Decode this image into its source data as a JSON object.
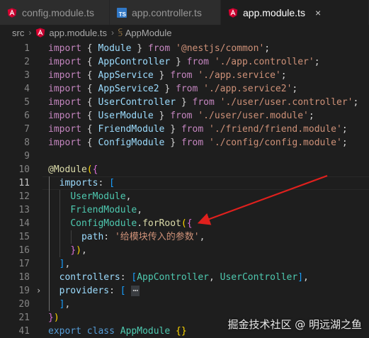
{
  "tabs": [
    {
      "label": "config.module.ts",
      "icon": "angular-icon",
      "active": false
    },
    {
      "label": "app.controller.ts",
      "icon": "typescript-icon",
      "active": false
    },
    {
      "label": "app.module.ts",
      "icon": "angular-icon",
      "active": true
    }
  ],
  "close_glyph": "×",
  "breadcrumb": {
    "folder": "src",
    "file": "app.module.ts",
    "symbol": "AppModule"
  },
  "lines": [
    {
      "n": "1",
      "t": [
        [
          "kw",
          "import"
        ],
        [
          "pun",
          " "
        ],
        [
          "pun",
          "{"
        ],
        [
          "id",
          " Module "
        ],
        [
          "pun",
          "}"
        ],
        [
          "kw",
          " from "
        ],
        [
          "str",
          "'@nestjs/common'"
        ],
        [
          "pun",
          ";"
        ]
      ]
    },
    {
      "n": "2",
      "t": [
        [
          "kw",
          "import"
        ],
        [
          "pun",
          " "
        ],
        [
          "pun",
          "{"
        ],
        [
          "id",
          " AppController "
        ],
        [
          "pun",
          "}"
        ],
        [
          "kw",
          " from "
        ],
        [
          "str",
          "'./app.controller'"
        ],
        [
          "pun",
          ";"
        ]
      ]
    },
    {
      "n": "3",
      "t": [
        [
          "kw",
          "import"
        ],
        [
          "pun",
          " "
        ],
        [
          "pun",
          "{"
        ],
        [
          "id",
          " AppService "
        ],
        [
          "pun",
          "}"
        ],
        [
          "kw",
          " from "
        ],
        [
          "str",
          "'./app.service'"
        ],
        [
          "pun",
          ";"
        ]
      ]
    },
    {
      "n": "4",
      "t": [
        [
          "kw",
          "import"
        ],
        [
          "pun",
          " "
        ],
        [
          "pun",
          "{"
        ],
        [
          "id",
          " AppService2 "
        ],
        [
          "pun",
          "}"
        ],
        [
          "kw",
          " from "
        ],
        [
          "str",
          "'./app.service2'"
        ],
        [
          "pun",
          ";"
        ]
      ]
    },
    {
      "n": "5",
      "t": [
        [
          "kw",
          "import"
        ],
        [
          "pun",
          " "
        ],
        [
          "pun",
          "{"
        ],
        [
          "id",
          " UserController "
        ],
        [
          "pun",
          "}"
        ],
        [
          "kw",
          " from "
        ],
        [
          "str",
          "'./user/user.controller'"
        ],
        [
          "pun",
          ";"
        ]
      ]
    },
    {
      "n": "6",
      "t": [
        [
          "kw",
          "import"
        ],
        [
          "pun",
          " "
        ],
        [
          "pun",
          "{"
        ],
        [
          "id",
          " UserModule "
        ],
        [
          "pun",
          "}"
        ],
        [
          "kw",
          " from "
        ],
        [
          "str",
          "'./user/user.module'"
        ],
        [
          "pun",
          ";"
        ]
      ]
    },
    {
      "n": "7",
      "t": [
        [
          "kw",
          "import"
        ],
        [
          "pun",
          " "
        ],
        [
          "pun",
          "{"
        ],
        [
          "id",
          " FriendModule "
        ],
        [
          "pun",
          "}"
        ],
        [
          "kw",
          " from "
        ],
        [
          "str",
          "'./friend/friend.module'"
        ],
        [
          "pun",
          ";"
        ]
      ]
    },
    {
      "n": "8",
      "t": [
        [
          "kw",
          "import"
        ],
        [
          "pun",
          " "
        ],
        [
          "pun",
          "{"
        ],
        [
          "id",
          " ConfigModule "
        ],
        [
          "pun",
          "}"
        ],
        [
          "kw",
          " from "
        ],
        [
          "str",
          "'./config/config.module'"
        ],
        [
          "pun",
          ";"
        ]
      ]
    },
    {
      "n": "9",
      "t": []
    },
    {
      "n": "10",
      "t": [
        [
          "fn",
          "@Module"
        ],
        [
          "b1",
          "("
        ],
        [
          "b2",
          "{"
        ]
      ]
    },
    {
      "n": "11",
      "t": [
        [
          "pun",
          "  "
        ],
        [
          "id",
          "imports"
        ],
        [
          "pun",
          ": "
        ],
        [
          "b3",
          "["
        ]
      ]
    },
    {
      "n": "12",
      "t": [
        [
          "pun",
          "    "
        ],
        [
          "cls",
          "UserModule"
        ],
        [
          "pun",
          ","
        ]
      ]
    },
    {
      "n": "13",
      "t": [
        [
          "pun",
          "    "
        ],
        [
          "cls",
          "FriendModule"
        ],
        [
          "pun",
          ","
        ]
      ]
    },
    {
      "n": "14",
      "t": [
        [
          "pun",
          "    "
        ],
        [
          "cls",
          "ConfigModule"
        ],
        [
          "pun",
          "."
        ],
        [
          "fn",
          "forRoot"
        ],
        [
          "b1",
          "("
        ],
        [
          "b2",
          "{"
        ]
      ]
    },
    {
      "n": "15",
      "t": [
        [
          "pun",
          "      "
        ],
        [
          "id",
          "path"
        ],
        [
          "pun",
          ": "
        ],
        [
          "str",
          "'给模块传入的参数'"
        ],
        [
          "pun",
          ","
        ]
      ]
    },
    {
      "n": "16",
      "t": [
        [
          "pun",
          "    "
        ],
        [
          "b2",
          "}"
        ],
        [
          "b1",
          ")"
        ],
        [
          "pun",
          ","
        ]
      ]
    },
    {
      "n": "17",
      "t": [
        [
          "pun",
          "  "
        ],
        [
          "b3",
          "]"
        ],
        [
          "pun",
          ","
        ]
      ]
    },
    {
      "n": "18",
      "t": [
        [
          "pun",
          "  "
        ],
        [
          "id",
          "controllers"
        ],
        [
          "pun",
          ": "
        ],
        [
          "b3",
          "["
        ],
        [
          "cls",
          "AppController"
        ],
        [
          "pun",
          ", "
        ],
        [
          "cls",
          "UserController"
        ],
        [
          "b3",
          "]"
        ],
        [
          "pun",
          ","
        ]
      ]
    },
    {
      "n": "19",
      "t": [
        [
          "pun",
          "  "
        ],
        [
          "id",
          "providers"
        ],
        [
          "pun",
          ": "
        ],
        [
          "b3",
          "["
        ],
        [
          "pun",
          " "
        ],
        [
          "ell",
          "⋯"
        ]
      ],
      "folded": true
    },
    {
      "n": "20",
      "t": [
        [
          "pun",
          "  "
        ],
        [
          "b3",
          "]"
        ],
        [
          "pun",
          ","
        ]
      ]
    },
    {
      "n": "21",
      "t": [
        [
          "b2",
          "}"
        ],
        [
          "b1",
          ")"
        ]
      ]
    },
    {
      "n": "41",
      "t": [
        [
          "kw2",
          "export"
        ],
        [
          "pun",
          " "
        ],
        [
          "kw2",
          "class"
        ],
        [
          "pun",
          " "
        ],
        [
          "cls",
          "AppModule"
        ],
        [
          "pun",
          " "
        ],
        [
          "b1",
          "{}"
        ]
      ]
    }
  ],
  "current_line": "11",
  "fold_glyph": "›",
  "watermark": "掘金技术社区 @ 明远湖之鱼",
  "colors": {
    "background": "#1e1e1e",
    "arrow": "#e0201d",
    "tab_bar": "#252526"
  }
}
